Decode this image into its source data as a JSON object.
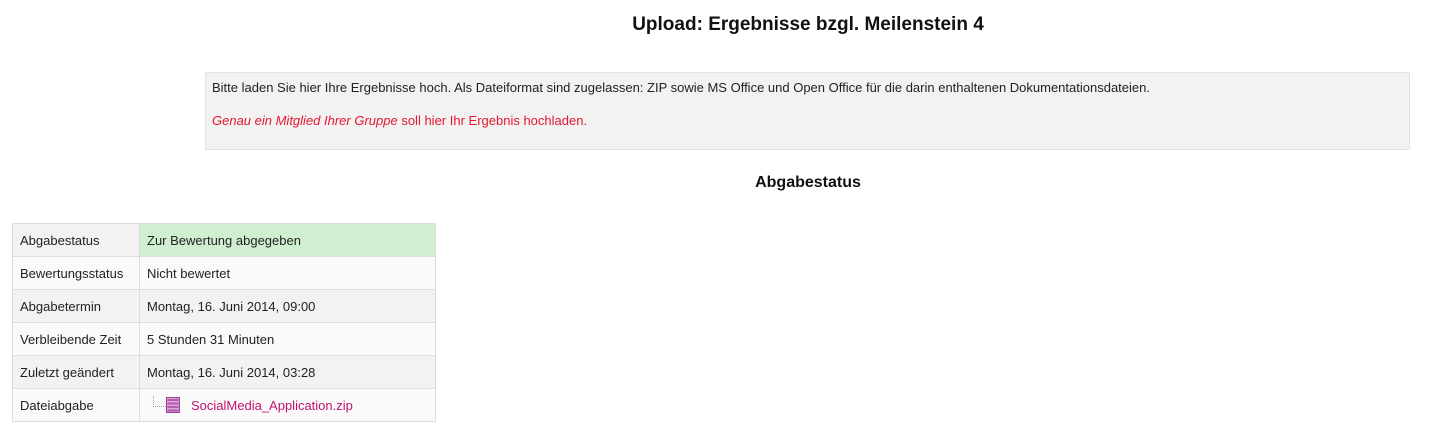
{
  "page": {
    "title": "Upload: Ergebnisse bzgl. Meilenstein 4"
  },
  "intro": {
    "text": "Bitte laden Sie hier Ihre Ergebnisse hoch. Als Dateiformat sind zugelassen: ZIP sowie MS Office und Open Office für die darin enthaltenen Dokumentationsdateien.",
    "note_emphasis": "Genau ein Mitglied Ihrer Gruppe",
    "note_rest": " soll hier Ihr Ergebnis hochladen.",
    "note_color": "#e4172f"
  },
  "section": {
    "title": "Abgabestatus"
  },
  "status_table": {
    "rows": [
      {
        "label": "Abgabestatus",
        "value": "Zur Bewertung abgegeben"
      },
      {
        "label": "Bewertungsstatus",
        "value": "Nicht bewertet"
      },
      {
        "label": "Abgabetermin",
        "value": "Montag, 16. Juni 2014, 09:00"
      },
      {
        "label": "Verbleibende Zeit",
        "value": "5 Stunden 31 Minuten"
      },
      {
        "label": "Zuletzt geändert",
        "value": "Montag, 16. Juni 2014, 03:28"
      },
      {
        "label": "Dateiabgabe",
        "file": "SocialMedia_Application.zip"
      }
    ],
    "status_ok_color": "#cfefd0",
    "file_icon": "zip-archive-icon",
    "link_color": "#c1136d"
  }
}
